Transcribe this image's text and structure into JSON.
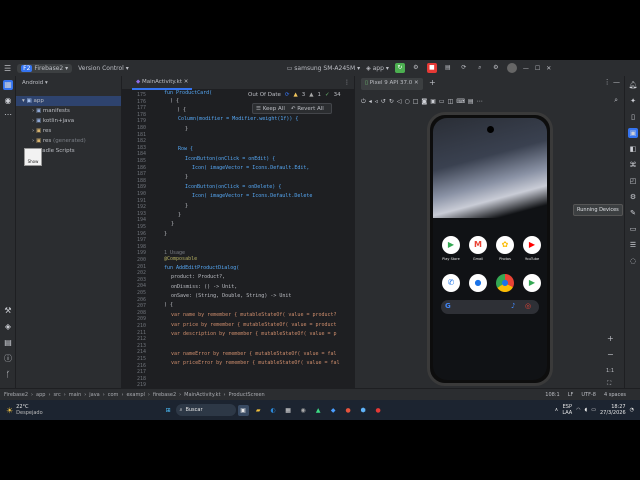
{
  "titlebar": {
    "project": "Firebase2",
    "vcs": "Version Control",
    "device": "samsung SM-A245M",
    "run_config": "app"
  },
  "project_panel": {
    "view": "Android",
    "items": [
      "app",
      "manifests",
      "kotlin+java",
      "res",
      "res",
      "(generated)",
      "radle Scripts"
    ],
    "tooltip": "Show"
  },
  "editor": {
    "tab": "MainActivity.kt",
    "line_numbers": [
      "175",
      "176",
      "177",
      "178",
      "179",
      "180",
      "181",
      "182",
      "183",
      "184",
      "185",
      "186",
      "187",
      "188",
      "189",
      "190",
      "191",
      "192",
      "193",
      "194",
      "195",
      "196",
      "197",
      "198",
      "199",
      "200",
      "201",
      "202",
      "203",
      "204",
      "205",
      "206",
      "207",
      "208",
      "209",
      "210",
      "211",
      "212",
      "213",
      "214",
      "215",
      "216",
      "217",
      "218",
      "219"
    ],
    "lines": [
      {
        "t": "fun ProductCard(",
        "c": "fn",
        "indent": 0
      },
      {
        "t": "  ) {",
        "c": "",
        "indent": 0
      },
      {
        "t": "  ) {",
        "c": "",
        "indent": 1
      },
      {
        "t": "Column(modifier = Modifier.weight(1f)) {",
        "c": "fn",
        "indent": 2
      },
      {
        "t": "}",
        "c": "",
        "indent": 3
      },
      {
        "t": "",
        "c": "",
        "indent": 0
      },
      {
        "t": "Row {",
        "c": "fn",
        "indent": 2
      },
      {
        "t": "IconButton(onClick = onEdit) {",
        "c": "fn",
        "indent": 3
      },
      {
        "t": "Icon( imageVector = Icons.Default.Edit,",
        "c": "fn",
        "indent": 4
      },
      {
        "t": "}",
        "c": "",
        "indent": 3
      },
      {
        "t": "IconButton(onClick = onDelete) {",
        "c": "fn",
        "indent": 3
      },
      {
        "t": "Icon( imageVector = Icons.Default.Delete",
        "c": "fn",
        "indent": 4
      },
      {
        "t": "}",
        "c": "",
        "indent": 3
      },
      {
        "t": "}",
        "c": "",
        "indent": 2
      },
      {
        "t": "}",
        "c": "",
        "indent": 1
      },
      {
        "t": "}",
        "c": "",
        "indent": 0
      },
      {
        "t": "",
        "c": "",
        "indent": 0
      },
      {
        "t": "1 Usage",
        "c": "gr",
        "indent": 0
      },
      {
        "t": "@Composable",
        "c": "an",
        "indent": 0
      },
      {
        "t": "fun AddEditProductDialog(",
        "c": "fn",
        "indent": 0
      },
      {
        "t": "product: Product?,",
        "c": "",
        "indent": 1
      },
      {
        "t": "onDismiss: () -> Unit,",
        "c": "",
        "indent": 1
      },
      {
        "t": "onSave: (String, Double, String) -> Unit",
        "c": "",
        "indent": 1
      },
      {
        "t": ") {",
        "c": "",
        "indent": 0
      },
      {
        "t": "var name by remember { mutableStateOf( value = product?",
        "c": "kw",
        "indent": 1
      },
      {
        "t": "var price by remember { mutableStateOf( value = product",
        "c": "kw",
        "indent": 1
      },
      {
        "t": "var description by remember { mutableStateOf( value = p",
        "c": "kw",
        "indent": 1
      },
      {
        "t": "",
        "c": "",
        "indent": 0
      },
      {
        "t": "var nameError by remember { mutableStateOf( value = fal",
        "c": "kw",
        "indent": 1
      },
      {
        "t": "var priceError by remember { mutableStateOf( value = fal",
        "c": "kw",
        "indent": 1
      }
    ],
    "status_out_of_date": "Out Of Date",
    "warnings": "3",
    "weak_warnings": "1",
    "typos": "34",
    "keep_all": "Keep All",
    "revert_all": "Revert All"
  },
  "running_devices": {
    "tab": "Pixel 9 API 37.0",
    "tooltip": "Running Devices",
    "apps_row1": [
      "Play Store",
      "Gmail",
      "Photos",
      "YouTube"
    ],
    "zoom_label": "1:1"
  },
  "statusbar": {
    "breadcrumbs": [
      "Firebase2",
      "app",
      "src",
      "main",
      "java",
      "com",
      "exampl",
      "firebase2",
      "MainActivity.kt",
      "ProductScreen"
    ],
    "position": "108:1",
    "line_ending": "LF",
    "encoding": "UTF-8",
    "indent": "4 spaces"
  },
  "taskbar": {
    "temperature": "22°C",
    "weather": "Despejado",
    "search": "Buscar",
    "lang": "ESP",
    "layout": "LAA",
    "time": "18:27",
    "date": "27/3/2026"
  },
  "colors": {
    "accent": "#3574f0",
    "run_green": "#4caf50",
    "stop_red": "#e53935"
  }
}
